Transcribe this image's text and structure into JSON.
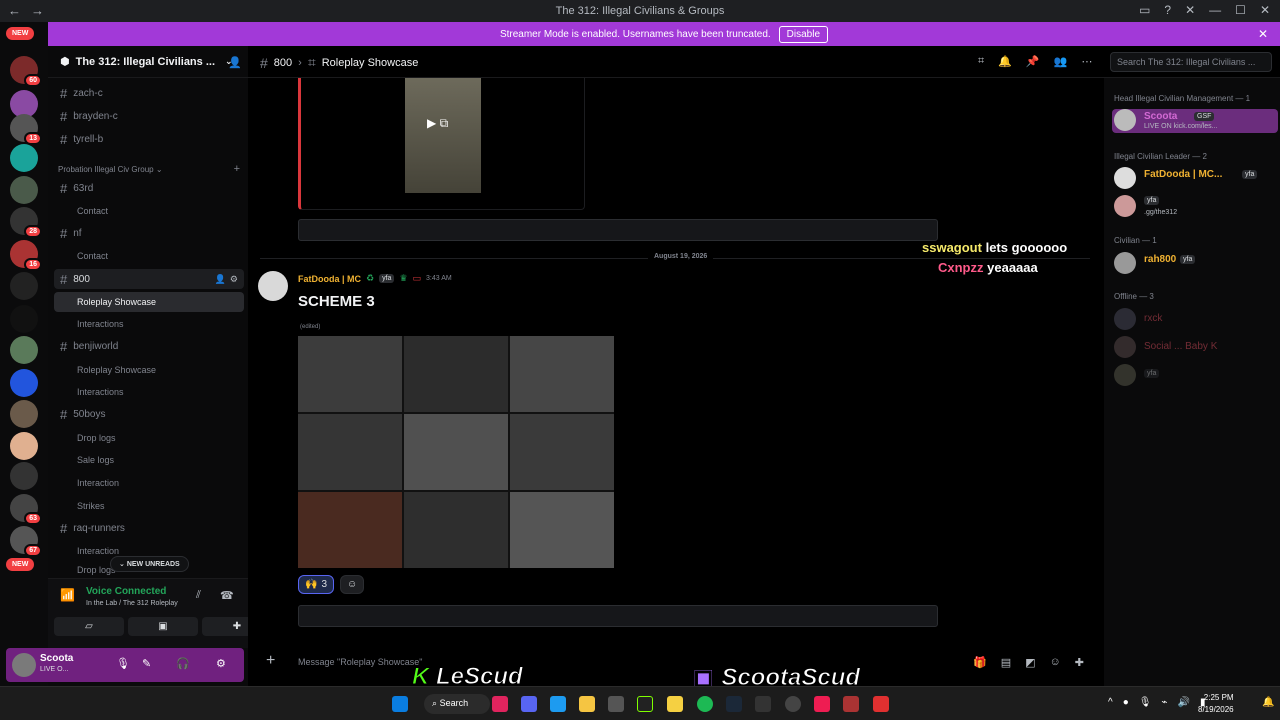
{
  "window": {
    "title": "The 312: Illegal Civilians & Groups",
    "nav_back": "←",
    "nav_forward": "→"
  },
  "servers": {
    "new_label_top": "NEW",
    "new_label_bottom": "NEW",
    "badges": [
      "60",
      "13",
      "28",
      "16",
      "63",
      "67"
    ]
  },
  "banner": {
    "text": "Streamer Mode is enabled. Usernames have been truncated.",
    "disable": "Disable"
  },
  "guild": {
    "name": "The 312: Illegal Civilians ...",
    "channels_top": [
      "zach-c",
      "brayden-c",
      "tyrell-b"
    ],
    "category": "Probation Illegal Civ Group",
    "ch_63rd": "63rd",
    "ch_63rd_sub": "Contact",
    "ch_nf": "nf",
    "ch_nf_sub": "Contact",
    "ch_800": "800",
    "ch_800_subs": [
      "Roleplay Showcase",
      "Interactions"
    ],
    "ch_benji": "benjiworld",
    "ch_benji_subs": [
      "Roleplay Showcase",
      "Interactions"
    ],
    "ch_50boys": "50boys",
    "ch_50boys_subs": [
      "Drop logs",
      "Sale logs",
      "Interaction",
      "Strikes"
    ],
    "ch_raq": "raq-runners",
    "ch_raq_subs": [
      "Interaction",
      "Drop logs"
    ],
    "new_unreads": "NEW UNREADS"
  },
  "voice": {
    "status": "Voice Connected",
    "location": "In the Lab / The 312 Roleplay"
  },
  "user": {
    "name": "Scoota",
    "status": "LIVE O..."
  },
  "header": {
    "channel": "800",
    "thread": "Roleplay Showcase",
    "search_placeholder": "Search The 312: Illegal Civilians ..."
  },
  "chat": {
    "date_separator": "August 19, 2026",
    "author": "FatDooda | MC",
    "tag": "yfa",
    "time": "3:43 AM",
    "title": "SCHEME 3",
    "edited": "(edited)",
    "reaction_emoji": "🙌",
    "reaction_count": "3",
    "composer_placeholder": "Message \"Roleplay Showcase\""
  },
  "stream_chat": {
    "user1": "sswagout",
    "msg1": "lets goooooo",
    "user2": "Cxnpzz",
    "msg2": "yeaaaaa"
  },
  "members": {
    "cat1": "Head Illegal Civilian Management — 1",
    "m1_name": "Scoota",
    "m1_tag": "GSF",
    "m1_sub": "LIVE ON kick.com/les...",
    "cat2": "Illegal Civilian Leader — 2",
    "m2_name": "FatDooda | MC...",
    "m2_tag": "yfa",
    "m3_tag": "yfa",
    "m3_sub": ".gg/the312",
    "cat3": "Civilian — 1",
    "m4_name": "rah800",
    "m4_tag": "yfa",
    "cat4": "Offline — 3",
    "m5_name": "rxck",
    "m6_name": "Social ... Baby K",
    "m7_tag": "yfa"
  },
  "overlay": {
    "brand_left": "LeScud",
    "brand_right": "ScootaScud"
  },
  "taskbar": {
    "search": "Search",
    "time": "2:25 PM",
    "date": "8/19/2026"
  },
  "colors": {
    "banner": "#a239d8",
    "accent_red": "#da373c",
    "voice_green": "#23a55a",
    "author_gold": "#f0b232",
    "member_pink": "#d36ad4"
  }
}
